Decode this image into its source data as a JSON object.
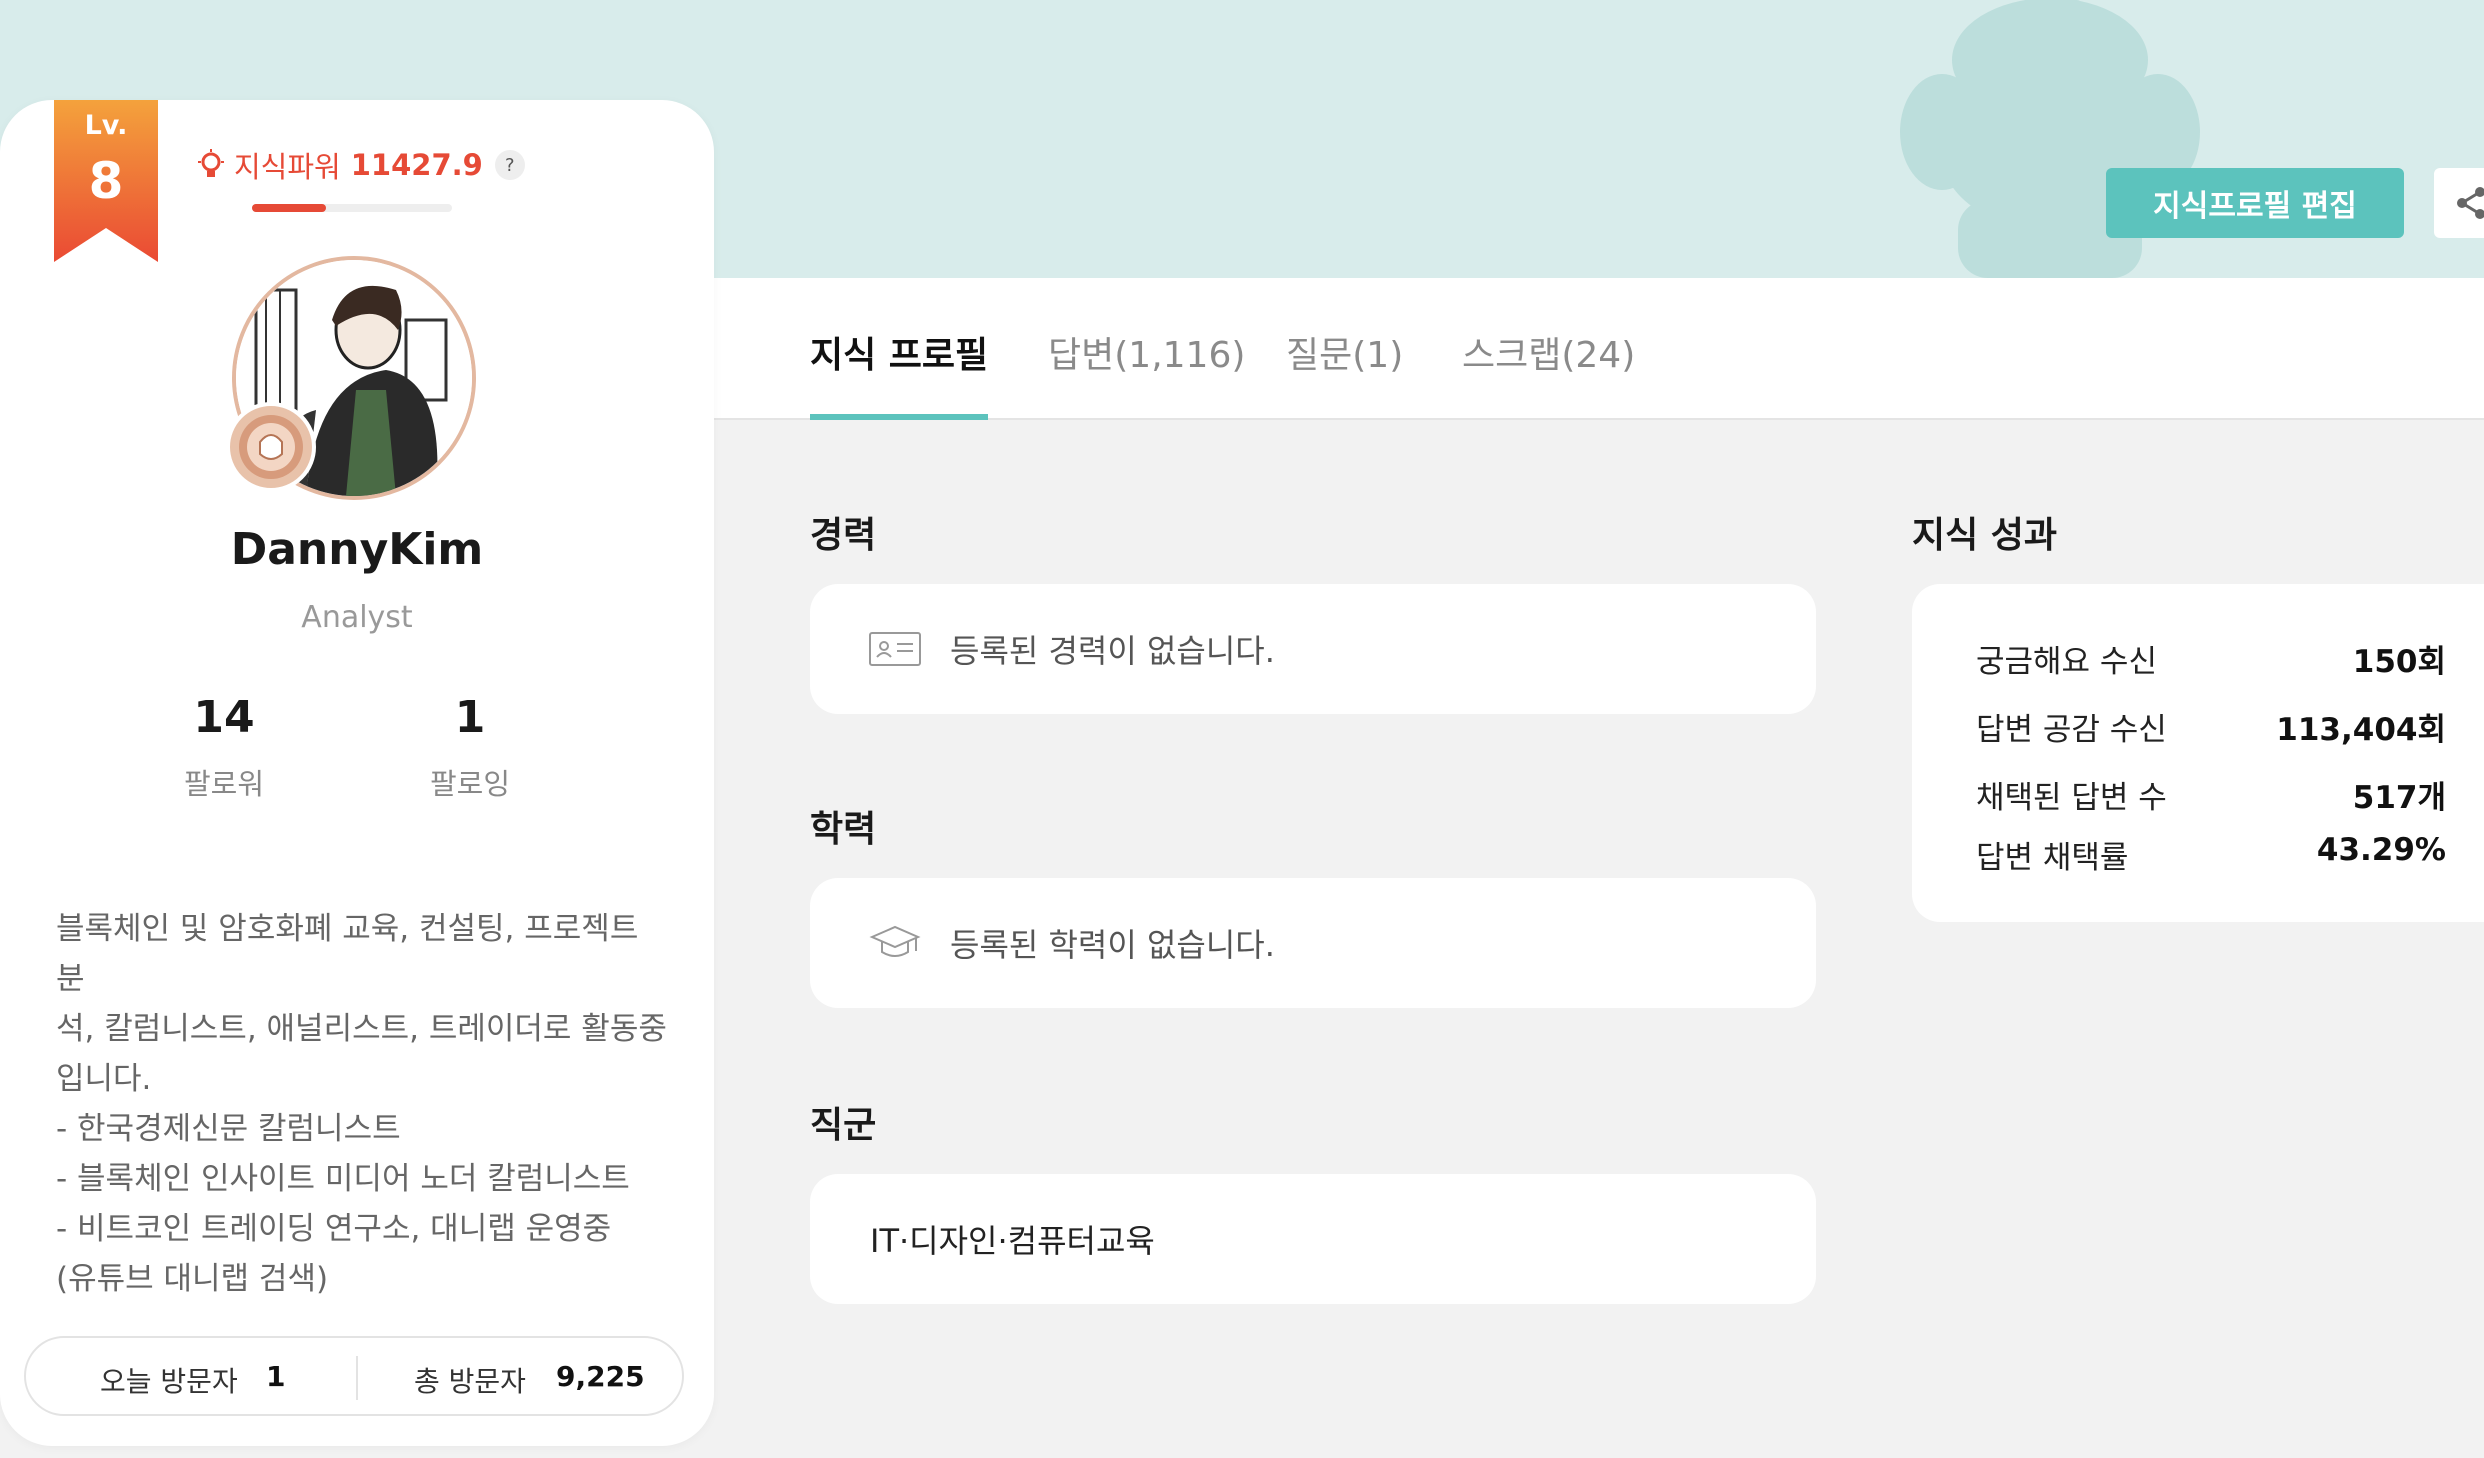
{
  "header": {
    "edit_button": "지식프로필 편집",
    "share_icon": "share-icon",
    "accent_color": "#5cc3bd"
  },
  "tabs": [
    {
      "label": "지식 프로필",
      "active": true
    },
    {
      "label": "답변(1,116)",
      "active": false
    },
    {
      "label": "질문(1)",
      "active": false
    },
    {
      "label": "스크랩(24)",
      "active": false
    }
  ],
  "profile": {
    "level_label": "Lv.",
    "level": "8",
    "knowledge_power_label": "지식파워",
    "knowledge_power_value": "11427.9",
    "help_label": "?",
    "power_progress": 0.37,
    "name": "DannyKim",
    "role": "Analyst",
    "followers_count": "14",
    "followers_label": "팔로워",
    "following_count": "1",
    "following_label": "팔로잉",
    "bio": "블록체인 및 암호화폐 교육, 컨설팅, 프로젝트 분\n석, 칼럼니스트, 애널리스트, 트레이더로 활동중\n입니다.\n- 한국경제신문 칼럼니스트\n- 블록체인 인사이트 미디어 노더 칼럼니스트\n- 비트코인 트레이딩 연구소, 대니랩 운영중\n(유튜브 대니랩 검색)",
    "today_visitors_label": "오늘 방문자",
    "today_visitors": "1",
    "total_visitors_label": "총 방문자",
    "total_visitors": "9,225",
    "accent_color": "#e64a36"
  },
  "sections": {
    "career_title": "경력",
    "career_empty": "등록된 경력이 없습니다.",
    "education_title": "학력",
    "education_empty": "등록된 학력이 없습니다.",
    "job_title": "직군",
    "job_value": "IT·디자인·컴퓨터교육"
  },
  "achievements": {
    "title": "지식 성과",
    "rows": [
      {
        "label": "궁금해요 수신",
        "value": "150회"
      },
      {
        "label": "답변 공감 수신",
        "value": "113,404회"
      },
      {
        "label": "채택된 답변 수",
        "value": "517개"
      },
      {
        "label": "답변 채택률",
        "value": "43.29%"
      }
    ]
  }
}
